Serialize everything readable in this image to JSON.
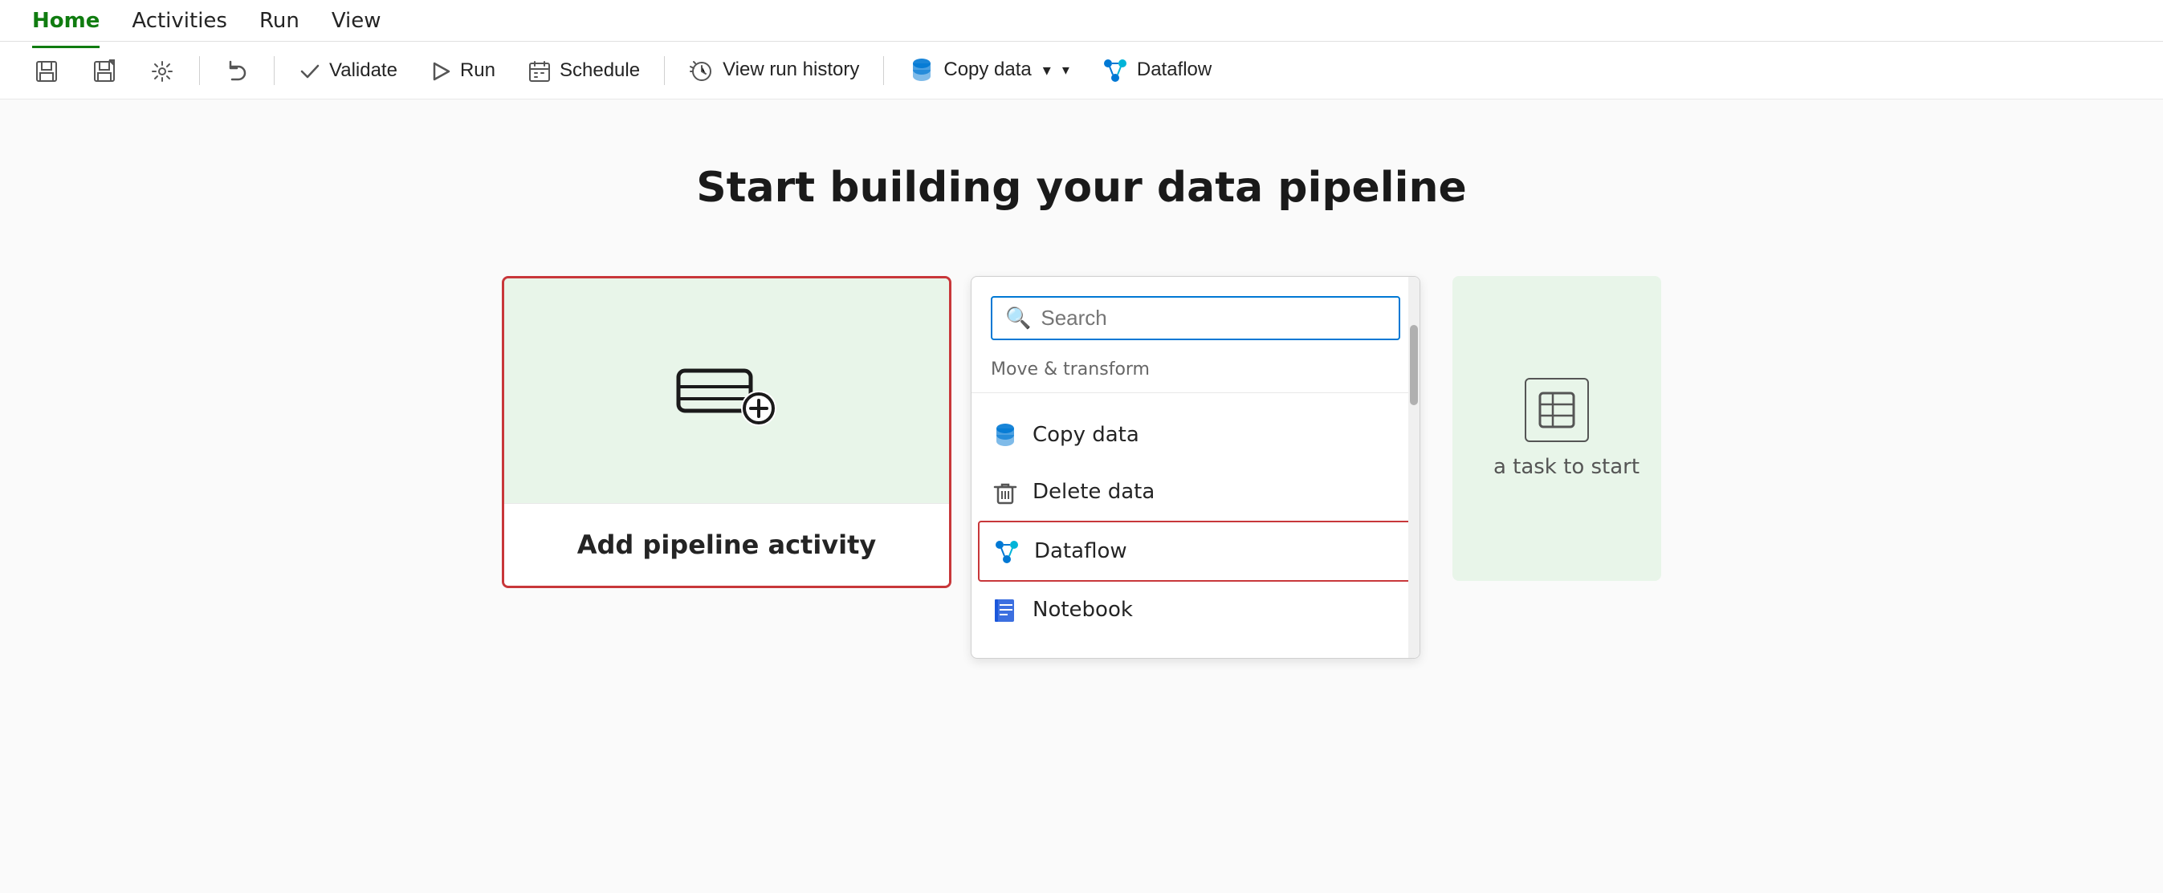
{
  "menu": {
    "items": [
      {
        "label": "Home",
        "active": true
      },
      {
        "label": "Activities",
        "active": false
      },
      {
        "label": "Run",
        "active": false
      },
      {
        "label": "View",
        "active": false
      }
    ]
  },
  "toolbar": {
    "buttons": [
      {
        "id": "save",
        "label": "",
        "icon": "save-icon"
      },
      {
        "id": "save-as",
        "label": "",
        "icon": "save-as-icon"
      },
      {
        "id": "settings",
        "label": "",
        "icon": "settings-icon"
      },
      {
        "id": "undo",
        "label": "",
        "icon": "undo-icon"
      },
      {
        "id": "validate",
        "label": "Validate",
        "icon": "check-icon"
      },
      {
        "id": "run",
        "label": "Run",
        "icon": "run-icon"
      },
      {
        "id": "schedule",
        "label": "Schedule",
        "icon": "schedule-icon"
      },
      {
        "id": "view-run-history",
        "label": "View run history",
        "icon": "history-icon"
      },
      {
        "id": "copy-data",
        "label": "Copy data",
        "icon": "copy-data-icon",
        "dropdown": true
      },
      {
        "id": "dataflow",
        "label": "Dataflow",
        "icon": "dataflow-icon"
      }
    ]
  },
  "main": {
    "title": "Start building your data pipeline",
    "pipeline_card": {
      "label": "Add pipeline activity",
      "icon_alt": "pipeline-add"
    },
    "dropdown": {
      "search_placeholder": "Search",
      "section_label": "Move & transform",
      "items": [
        {
          "id": "copy-data",
          "label": "Copy data",
          "icon": "copy-data"
        },
        {
          "id": "delete-data",
          "label": "Delete data",
          "icon": "delete-data"
        },
        {
          "id": "dataflow",
          "label": "Dataflow",
          "icon": "dataflow",
          "selected": true
        },
        {
          "id": "notebook",
          "label": "Notebook",
          "icon": "notebook"
        }
      ]
    },
    "right_hint": {
      "text": "a task to start"
    }
  }
}
